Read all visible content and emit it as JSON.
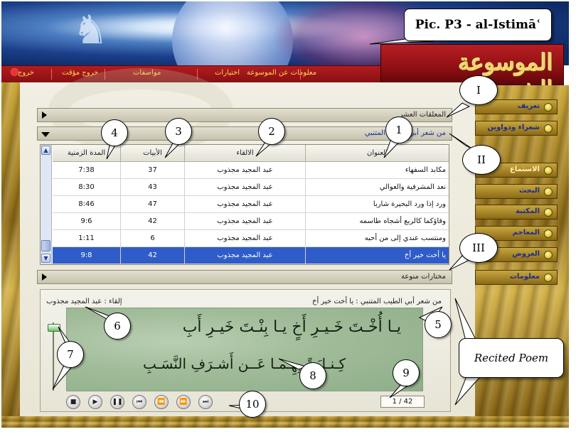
{
  "caption": "Pic. P3 - al-Istimāʿ",
  "logo_text": "الموسوعة الشعرية",
  "menu": [
    {
      "label": "معلومات عن الموسوعة"
    },
    {
      "label": "اختيارات"
    },
    {
      "label": "مواصفات"
    },
    {
      "label": "خروج مؤقت"
    },
    {
      "label": "خروج"
    }
  ],
  "sections": {
    "s1": "المعلقات العشر",
    "s2": "من شعر أبي الطيب المتنبي",
    "s3": "مختارات منوعة"
  },
  "table": {
    "headers": {
      "title": "العنوان",
      "reciter": "الالقاء",
      "verses": "الأبيات",
      "duration": "المدة الزمنية"
    },
    "rows": [
      {
        "title": "مكابد السفهاء",
        "reciter": "عبد المجيد مجذوب",
        "verses": "37",
        "duration": "7:38"
      },
      {
        "title": "نعد المشرفية والعوالي",
        "reciter": "عبد المجيد مجذوب",
        "verses": "43",
        "duration": "8:30"
      },
      {
        "title": "ورد إذا ورد البحيرة شاربا",
        "reciter": "عبد المجيد مجذوب",
        "verses": "47",
        "duration": "8:46"
      },
      {
        "title": "وفاؤكما كالربع أشجاه طاسمه",
        "reciter": "عبد المجيد مجذوب",
        "verses": "42",
        "duration": "9:6"
      },
      {
        "title": "ومنتسب عندي إلى من أحبه",
        "reciter": "عبد المجيد مجذوب",
        "verses": "6",
        "duration": "1:11"
      },
      {
        "title": "يا أخت خير أخ",
        "reciter": "عبد المجيد مجذوب",
        "verses": "42",
        "duration": "9:8"
      }
    ],
    "selected_index": 5
  },
  "player": {
    "poem_heading": "من شعر أبي الطيب المتنبي : يا أخت خير أخ",
    "reciter_line": "إلقاء : عبد المجيد مجذوب",
    "verse1": "يـا أُخْـتَ خَـيـرِ أَخٍ يـا بِنْـتَ خَيـرِ أَبِ",
    "verse2": "كِـنـايَـةً بِهِـمـا عَــن أَشـرَفِ النَّسَـبِ",
    "counter": "1 / 42",
    "volume_fraction": 0.95,
    "controls": [
      "stop",
      "play",
      "pause",
      "first",
      "rewind",
      "forward",
      "last"
    ],
    "control_glyphs": {
      "stop": "■",
      "play": "▶",
      "pause": "❚❚",
      "first": "⏮",
      "rewind": "⏪",
      "forward": "⏩",
      "last": "⏭"
    }
  },
  "nav": [
    {
      "label": "تعريف"
    },
    {
      "label": "شعراء ودواوين"
    },
    {
      "label": "الاستماع"
    },
    {
      "label": "البحث"
    },
    {
      "label": "المكتبة"
    },
    {
      "label": "المعاجم"
    },
    {
      "label": "العروض"
    },
    {
      "label": "معلومات"
    }
  ],
  "callouts": {
    "n1": "1",
    "n2": "2",
    "n3": "3",
    "n4": "4",
    "n5": "5",
    "n6": "6",
    "n7": "7",
    "n8": "8",
    "n9": "9",
    "n10": "10",
    "r1": "I",
    "r2": "II",
    "r3": "III",
    "recited": "Recited Poem"
  }
}
